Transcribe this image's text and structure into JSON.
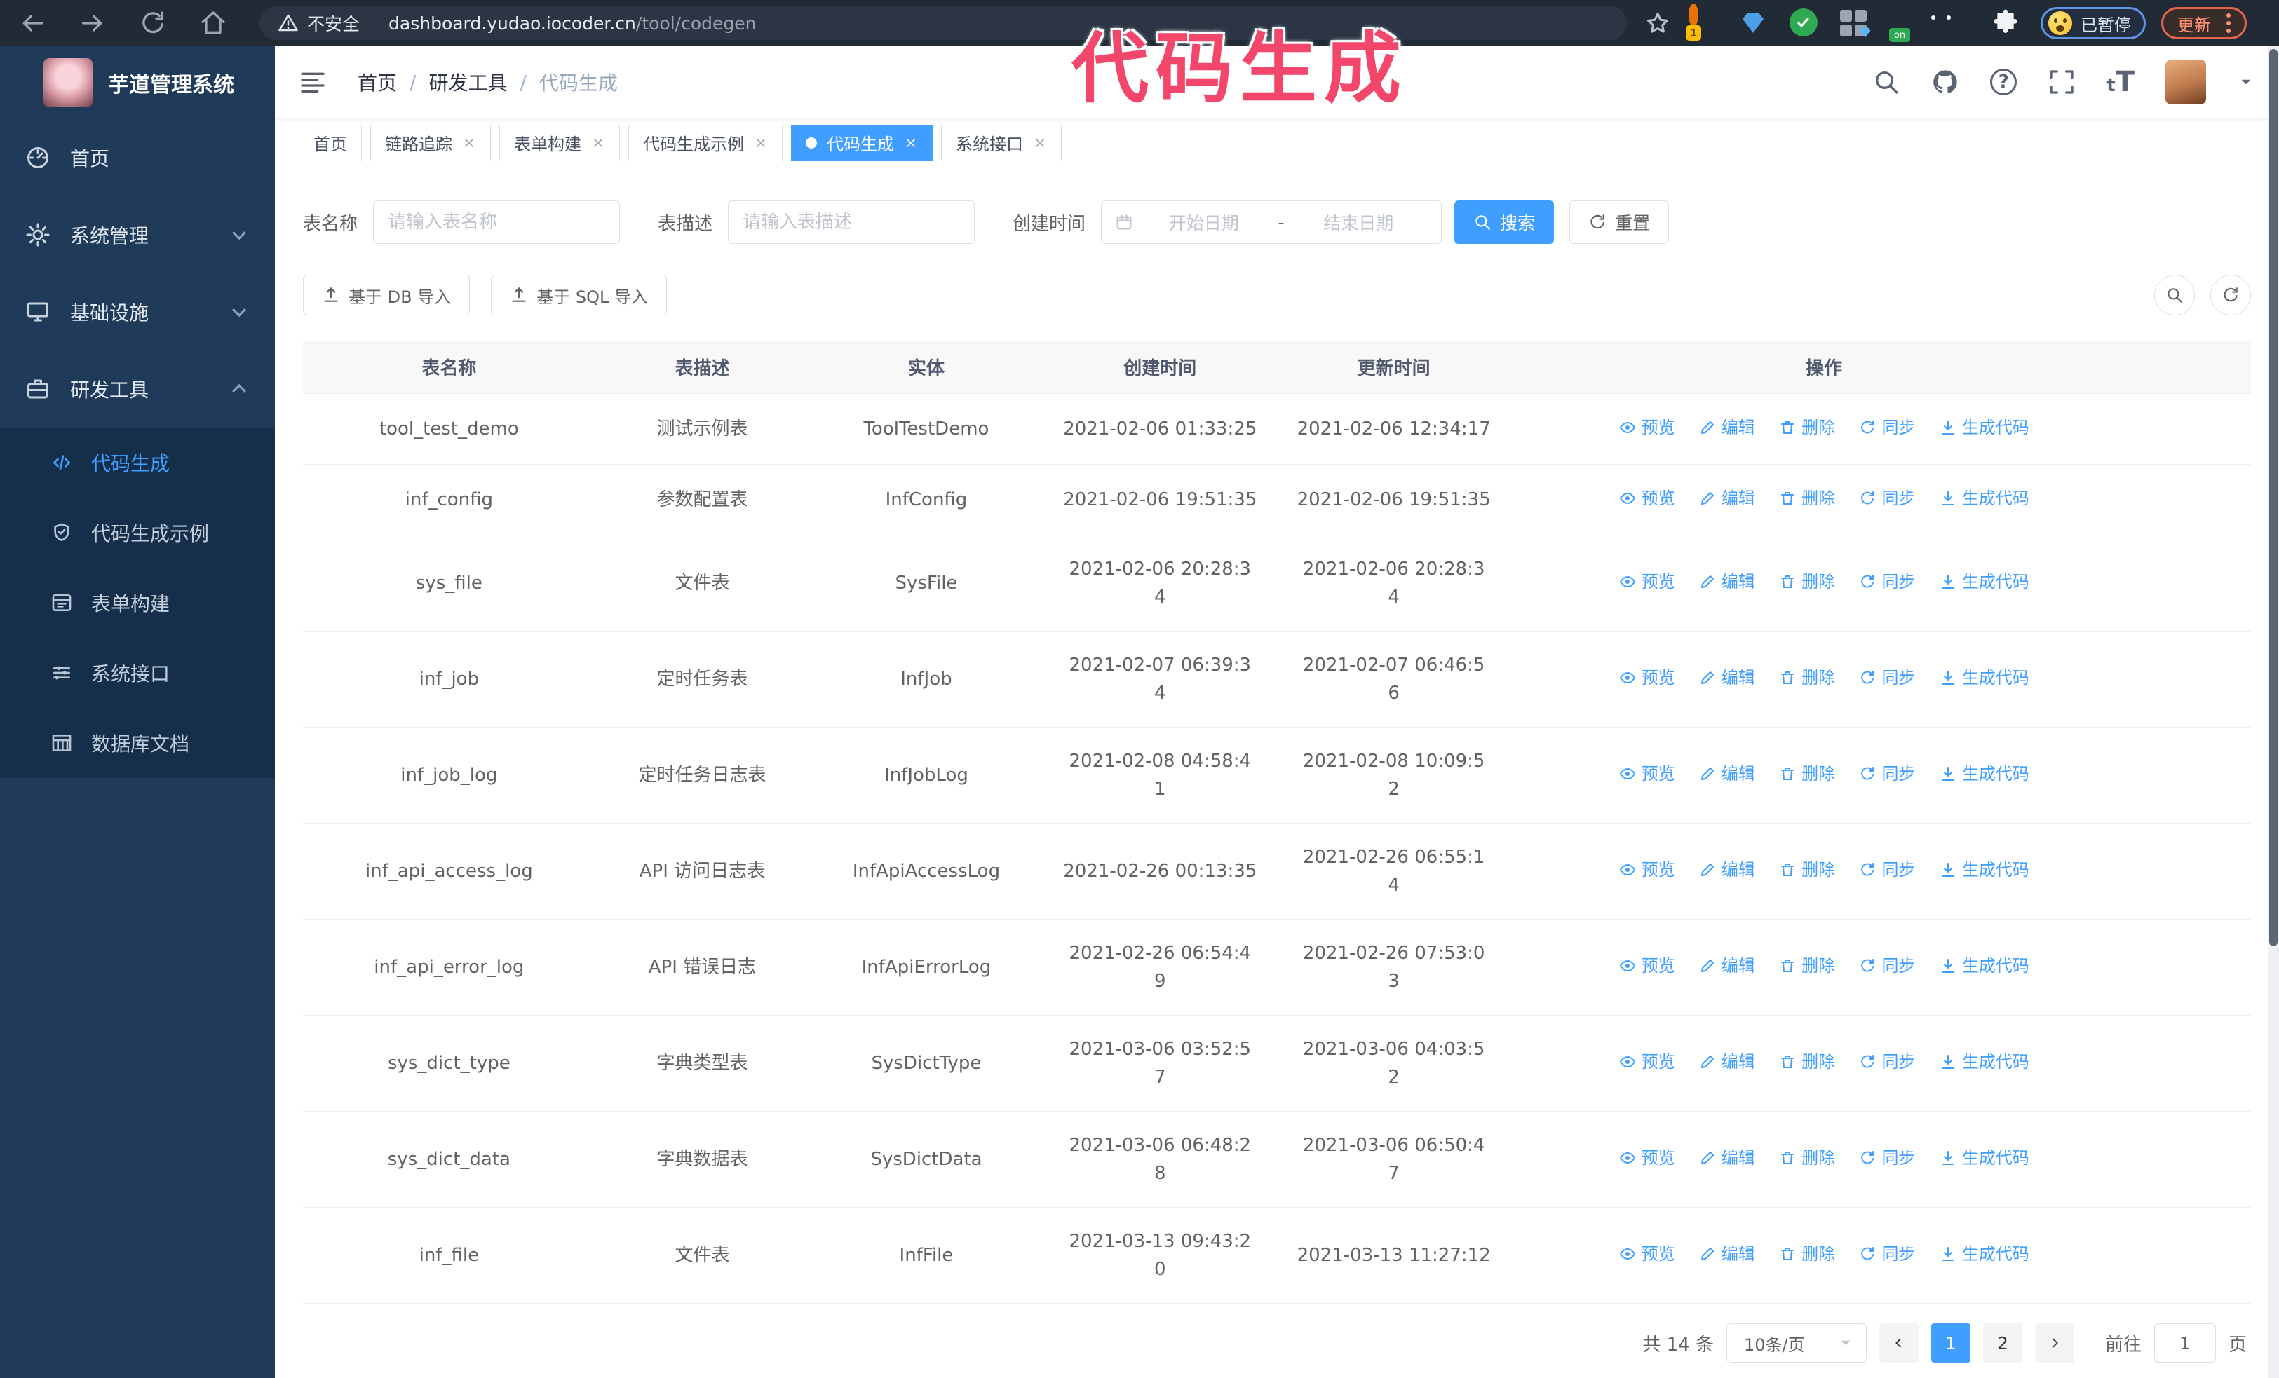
{
  "annotation": {
    "text": "代码生成",
    "color": "#f2476a"
  },
  "browser": {
    "security_label": "不安全",
    "url_host": "dashboard.yudao.iocoder.cn",
    "url_path": "/tool/codegen",
    "ext1_badge": "1",
    "ext_on_badge": "on",
    "paused_label": "已暂停",
    "update_label": "更新"
  },
  "sidebar": {
    "title": "芋道管理系统",
    "items": [
      {
        "label": "首页"
      },
      {
        "label": "系统管理"
      },
      {
        "label": "基础设施"
      },
      {
        "label": "研发工具"
      }
    ],
    "subitems": [
      {
        "label": "代码生成"
      },
      {
        "label": "代码生成示例"
      },
      {
        "label": "表单构建"
      },
      {
        "label": "系统接口"
      },
      {
        "label": "数据库文档"
      }
    ]
  },
  "header": {
    "breadcrumb": [
      "首页",
      "研发工具",
      "代码生成"
    ],
    "breadcrumb_separator": "/",
    "help_glyph": "?",
    "fontsize_small": "t",
    "fontsize_big": "T"
  },
  "tabs": [
    "首页",
    "链路追踪",
    "表单构建",
    "代码生成示例",
    "代码生成",
    "系统接口"
  ],
  "filters": {
    "name_label": "表名称",
    "name_placeholder": "请输入表名称",
    "desc_label": "表描述",
    "desc_placeholder": "请输入表描述",
    "time_label": "创建时间",
    "start_placeholder": "开始日期",
    "range_separator": "-",
    "end_placeholder": "结束日期",
    "search_label": "搜索",
    "reset_label": "重置"
  },
  "toolbar": {
    "db_import_label": "基于 DB 导入",
    "sql_import_label": "基于 SQL 导入"
  },
  "table": {
    "columns": [
      "表名称",
      "表描述",
      "实体",
      "创建时间",
      "更新时间",
      "操作"
    ],
    "ops": [
      "预览",
      "编辑",
      "删除",
      "同步",
      "生成代码"
    ],
    "rows": [
      {
        "name": "tool_test_demo",
        "desc": "测试示例表",
        "entity": "ToolTestDemo",
        "created": "2021-02-06 01:33:25",
        "updated": "2021-02-06 12:34:17"
      },
      {
        "name": "inf_config",
        "desc": "参数配置表",
        "entity": "InfConfig",
        "created": "2021-02-06 19:51:35",
        "updated": "2021-02-06 19:51:35"
      },
      {
        "name": "sys_file",
        "desc": "文件表",
        "entity": "SysFile",
        "created": "2021-02-06 20:28:3\n4",
        "updated": "2021-02-06 20:28:3\n4"
      },
      {
        "name": "inf_job",
        "desc": "定时任务表",
        "entity": "InfJob",
        "created": "2021-02-07 06:39:3\n4",
        "updated": "2021-02-07 06:46:5\n6"
      },
      {
        "name": "inf_job_log",
        "desc": "定时任务日志表",
        "entity": "InfJobLog",
        "created": "2021-02-08 04:58:4\n1",
        "updated": "2021-02-08 10:09:5\n2"
      },
      {
        "name": "inf_api_access_log",
        "desc": "API 访问日志表",
        "entity": "InfApiAccessLog",
        "created": "2021-02-26 00:13:35",
        "updated": "2021-02-26 06:55:1\n4"
      },
      {
        "name": "inf_api_error_log",
        "desc": "API 错误日志",
        "entity": "InfApiErrorLog",
        "created": "2021-02-26 06:54:4\n9",
        "updated": "2021-02-26 07:53:0\n3"
      },
      {
        "name": "sys_dict_type",
        "desc": "字典类型表",
        "entity": "SysDictType",
        "created": "2021-03-06 03:52:5\n7",
        "updated": "2021-03-06 04:03:5\n2"
      },
      {
        "name": "sys_dict_data",
        "desc": "字典数据表",
        "entity": "SysDictData",
        "created": "2021-03-06 06:48:2\n8",
        "updated": "2021-03-06 06:50:4\n7"
      },
      {
        "name": "inf_file",
        "desc": "文件表",
        "entity": "InfFile",
        "created": "2021-03-13 09:43:2\n0",
        "updated": "2021-03-13 11:27:12"
      }
    ]
  },
  "pagination": {
    "total_label": "共 14 条",
    "page_size_label": "10条/页",
    "pages": [
      "1",
      "2"
    ],
    "goto_label": "前往",
    "goto_value": "1",
    "page_suffix": "页"
  }
}
